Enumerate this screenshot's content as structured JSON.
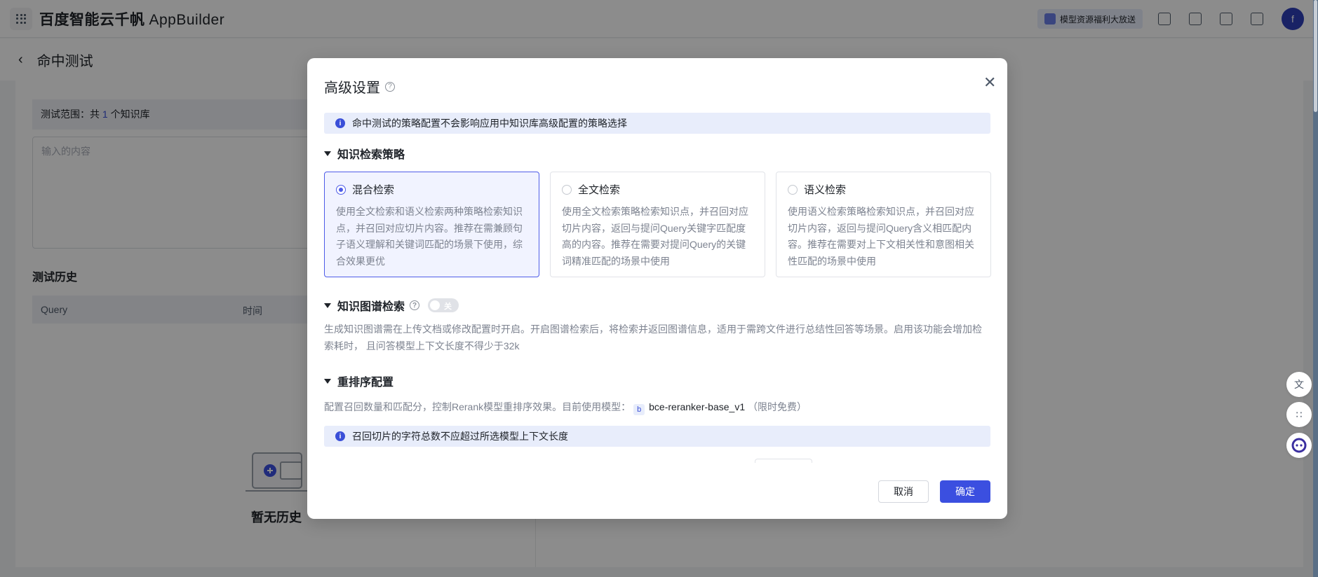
{
  "topbar": {
    "brand": "百度智能云千帆",
    "app": "AppBuilder",
    "promo": "模型资源福利大放送",
    "avatar_letter": "f"
  },
  "page": {
    "title": "命中测试",
    "scope_prefix": "测试范围：共 ",
    "scope_count": "1",
    "scope_suffix": " 个知识库",
    "input_placeholder": "输入的内容",
    "history_title": "测试历史",
    "table_headers": [
      "Query",
      "时间"
    ],
    "empty_text": "暂无历史"
  },
  "modal": {
    "title": "高级设置",
    "notice": "命中测试的策略配置不会影响应用中知识库高级配置的策略选择",
    "retrieval": {
      "heading": "知识检索策略",
      "options": [
        {
          "label": "混合检索",
          "selected": true,
          "desc": "使用全文检索和语义检索两种策略检索知识点，并召回对应切片内容。推荐在需兼顾句子语义理解和关键词匹配的场景下使用，综合效果更优"
        },
        {
          "label": "全文检索",
          "selected": false,
          "desc": "使用全文检索策略检索知识点，并召回对应切片内容，返回与提问Query关键字匹配度高的内容。推荐在需要对提问Query的关键词精准匹配的场景中使用"
        },
        {
          "label": "语义检索",
          "selected": false,
          "desc": "使用语义检索策略检索知识点，并召回对应切片内容，返回与提问Query含义相匹配内容。推荐在需要对上下文相关性和意图相关性匹配的场景中使用"
        }
      ]
    },
    "graph": {
      "heading": "知识图谱检索",
      "toggle_label": "关",
      "toggle_on": false,
      "desc": "生成知识图谱需在上传文档或修改配置时开启。开启图谱检索后，将检索并返回图谱信息，适用于需跨文件进行总结性回答等场景。启用该功能会增加检索耗时， 且问答模型上下文长度不得少于32k"
    },
    "rerank": {
      "heading": "重排序配置",
      "desc_prefix": "配置召回数量和匹配分，控制Rerank模型重排序效果。目前使用模型：",
      "model_badge": "b",
      "model_name": "bce-reranker-base_v1",
      "model_note": "（限时免费）",
      "warning": "召回切片的字符总数不应超过所选模型上下文长度"
    },
    "cancel_label": "取消",
    "confirm_label": "确定"
  },
  "colors": {
    "accent": "#3b4fe0",
    "info_bg": "#e8edfb",
    "overlay": "rgba(0,0,0,0.45)"
  }
}
